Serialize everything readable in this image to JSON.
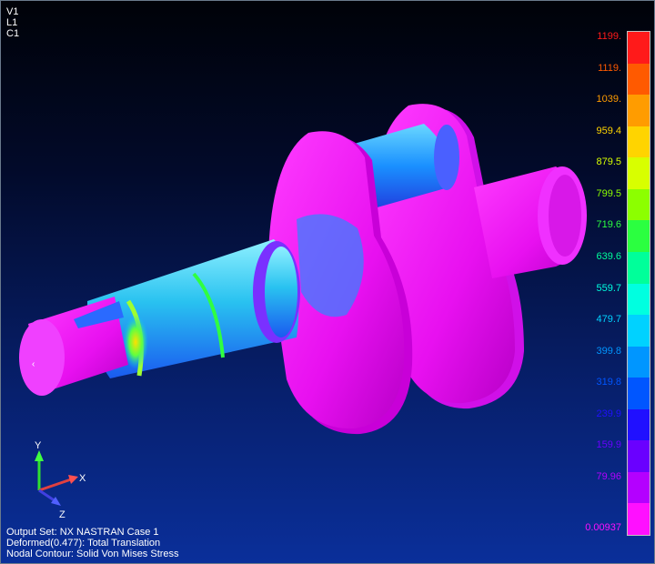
{
  "view_labels": [
    "V1",
    "L1",
    "C1"
  ],
  "info_lines": [
    "Output Set: NX NASTRAN Case 1",
    "Deformed(0.477): Total Translation",
    "Nodal Contour: Solid Von Mises Stress"
  ],
  "legend": {
    "labels": [
      "1199.",
      "1119.",
      "1039.",
      "959.4",
      "879.5",
      "799.5",
      "719.6",
      "639.6",
      "559.7",
      "479.7",
      "399.8",
      "319.8",
      "239.9",
      "159.9",
      "79.96",
      "0.00937"
    ],
    "colors": [
      "#ff1a1a",
      "#ff5a00",
      "#ff9c00",
      "#ffd400",
      "#d8ff00",
      "#8cff00",
      "#2bff40",
      "#00ff9a",
      "#00ffe0",
      "#00d2ff",
      "#0096ff",
      "#0056ff",
      "#2010ff",
      "#6a00ff",
      "#b400ff",
      "#ff10ff"
    ]
  },
  "triad": {
    "y_label": "Y",
    "x_label": "X",
    "z_label": "Z"
  }
}
